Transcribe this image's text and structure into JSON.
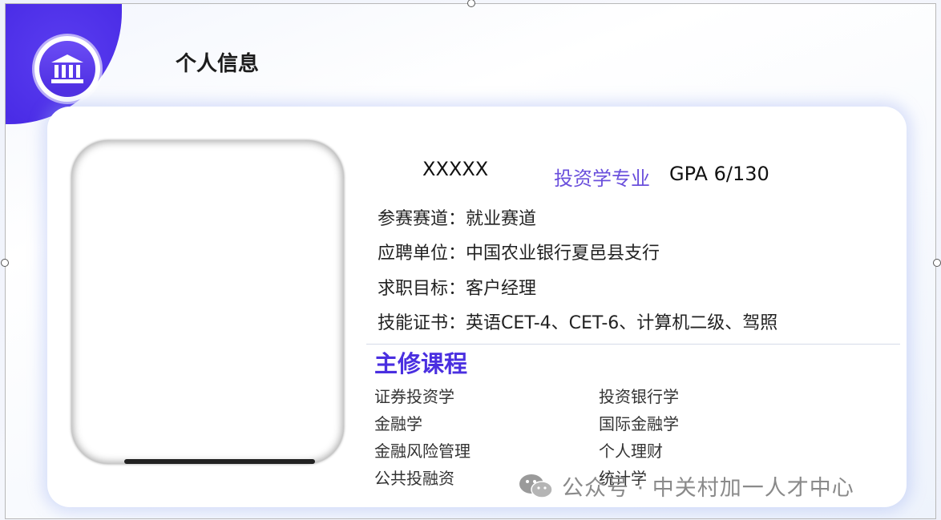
{
  "header": {
    "title": "个人信息"
  },
  "profile": {
    "name": "XXXXX",
    "major": "投资学专业",
    "gpa": "GPA 6/130",
    "rows": [
      {
        "label": "参赛赛道：",
        "value": "就业赛道"
      },
      {
        "label": "应聘单位：",
        "value": "中国农业银行夏邑县支行"
      },
      {
        "label": "求职目标：",
        "value": "客户经理"
      },
      {
        "label": "技能证书：",
        "value": "英语CET-4、CET-6、计算机二级、驾照"
      }
    ]
  },
  "courses": {
    "title": "主修课程",
    "left": [
      "证券投资学",
      "金融学",
      "金融风险管理",
      "公共投融资"
    ],
    "right": [
      "投资银行学",
      "国际金融学",
      "个人理财",
      "统计学"
    ]
  },
  "watermark": {
    "text": "公众号 · 中关村加一人才中心"
  },
  "icons": {
    "badge": "bank-icon",
    "watermark": "wechat-icon"
  },
  "colors": {
    "accent": "#4a2fe0",
    "major": "#6a4fdc"
  }
}
